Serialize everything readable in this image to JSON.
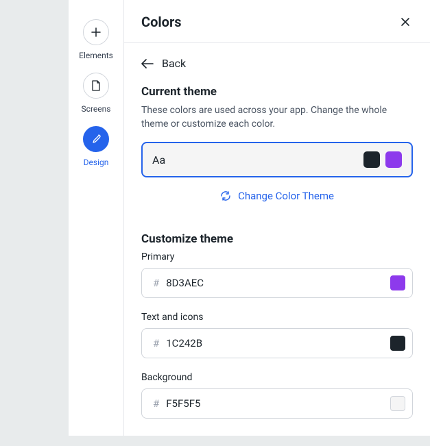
{
  "sidebar": {
    "items": [
      {
        "label": "Elements"
      },
      {
        "label": "Screens"
      },
      {
        "label": "Design"
      }
    ]
  },
  "panel": {
    "title": "Colors",
    "back_label": "Back"
  },
  "current_theme": {
    "heading": "Current theme",
    "description": "These colors are used across your app. Change the whole theme or customize each color.",
    "preview_text": "Aa",
    "swatch_dark": "#1c242b",
    "swatch_primary": "#8d3aec",
    "change_label": "Change Color Theme"
  },
  "customize": {
    "heading": "Customize theme",
    "fields": [
      {
        "label": "Primary",
        "hex": "8D3AEC",
        "color": "#8d3aec",
        "bordered": false
      },
      {
        "label": "Text and icons",
        "hex": "1C242B",
        "color": "#1c242b",
        "bordered": false
      },
      {
        "label": "Background",
        "hex": "F5F5F5",
        "color": "#f5f5f5",
        "bordered": true
      }
    ]
  }
}
